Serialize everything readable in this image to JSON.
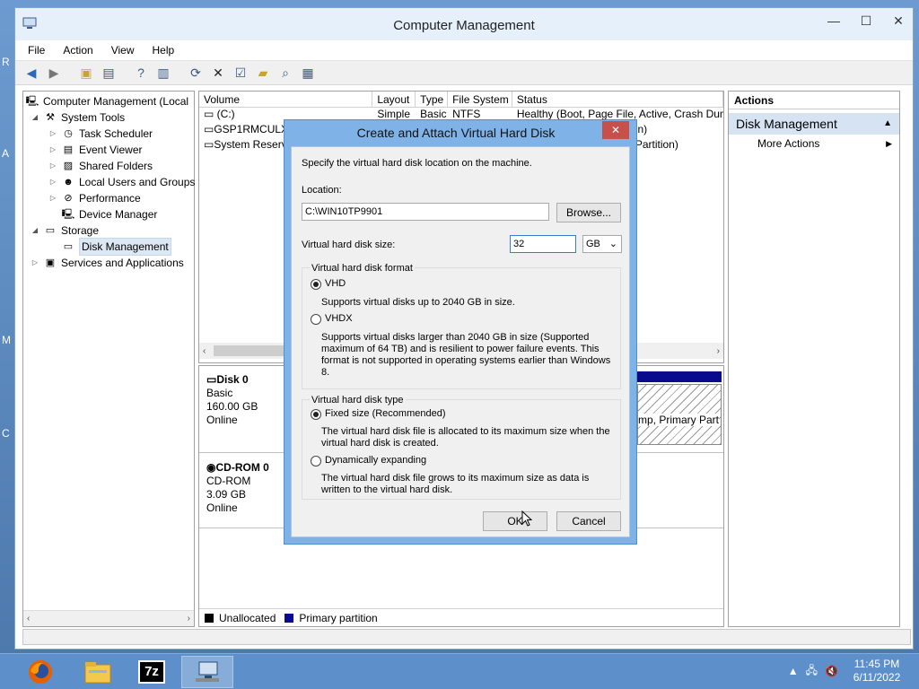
{
  "window": {
    "title": "Computer Management",
    "controls": {
      "minimize": "—",
      "maximize": "☐",
      "close": "✕"
    }
  },
  "menu": [
    "File",
    "Action",
    "View",
    "Help"
  ],
  "tree": {
    "items": [
      {
        "label": "Computer Management (Local",
        "icon": "computer-icon",
        "level": 0,
        "expander": ""
      },
      {
        "label": "System Tools",
        "icon": "tools-icon",
        "level": 1,
        "expander": "◢"
      },
      {
        "label": "Task Scheduler",
        "icon": "clock-icon",
        "level": 2,
        "expander": "▷"
      },
      {
        "label": "Event Viewer",
        "icon": "event-viewer-icon",
        "level": 2,
        "expander": "▷"
      },
      {
        "label": "Shared Folders",
        "icon": "shared-folder-icon",
        "level": 2,
        "expander": "▷"
      },
      {
        "label": "Local Users and Groups",
        "icon": "users-icon",
        "level": 2,
        "expander": "▷"
      },
      {
        "label": "Performance",
        "icon": "performance-icon",
        "level": 2,
        "expander": "▷"
      },
      {
        "label": "Device Manager",
        "icon": "device-manager-icon",
        "level": 2,
        "expander": ""
      },
      {
        "label": "Storage",
        "icon": "storage-icon",
        "level": 1,
        "expander": "◢"
      },
      {
        "label": "Disk Management",
        "icon": "disk-management-icon",
        "level": 2,
        "expander": "",
        "selected": true
      },
      {
        "label": "Services and Applications",
        "icon": "services-icon",
        "level": 1,
        "expander": "▷"
      }
    ]
  },
  "volumes": {
    "columns": [
      "Volume",
      "Layout",
      "Type",
      "File System",
      "Status"
    ],
    "rows": [
      [
        "(C:)",
        "Simple",
        "Basic",
        "NTFS",
        "Healthy (Boot, Page File, Active, Crash Dum"
      ],
      [
        "GSP1RMCULXI",
        "",
        "",
        "",
        "n)"
      ],
      [
        "System Reserv",
        "",
        "",
        "",
        "r Partition)"
      ]
    ]
  },
  "disks": [
    {
      "name": "Disk 0",
      "type": "Basic",
      "size": "160.00 GB",
      "status": "Online"
    },
    {
      "name": "CD-ROM 0",
      "type": "CD-ROM",
      "size": "3.09 GB",
      "status": "Online"
    }
  ],
  "partition_label": "mp, Primary Part",
  "legend": [
    {
      "label": "Unallocated",
      "color": "#000000"
    },
    {
      "label": "Primary partition",
      "color": "#0a0a8c"
    }
  ],
  "actions": {
    "header": "Actions",
    "selected": "Disk Management",
    "more": "More Actions"
  },
  "dialog": {
    "title": "Create and Attach Virtual Hard Disk",
    "close": "✕",
    "intro": "Specify the virtual hard disk location on the machine.",
    "location_label": "Location:",
    "location_value": "C:\\WIN10TP9901",
    "browse": "Browse...",
    "size_label": "Virtual hard disk size:",
    "size_value": "32",
    "size_unit": "GB",
    "format_group": "Virtual hard disk format",
    "vhd_label": "VHD",
    "vhd_desc": "Supports virtual disks up to 2040 GB in size.",
    "vhdx_label": "VHDX",
    "vhdx_desc": "Supports virtual disks larger than 2040 GB in size (Supported maximum of 64 TB) and is resilient to power failure events. This format is not supported in operating systems earlier than Windows 8.",
    "type_group": "Virtual hard disk type",
    "fixed_label": "Fixed size (Recommended)",
    "fixed_desc": "The virtual hard disk file is allocated to its maximum size when the virtual hard disk is created.",
    "dynamic_label": "Dynamically expanding",
    "dynamic_desc": "The virtual hard disk file grows to its maximum size as data is written to the virtual hard disk.",
    "ok": "OK",
    "cancel": "Cancel"
  },
  "taskbar": {
    "apps": [
      "firefox-icon",
      "file-explorer-icon",
      "7zip-icon",
      "computer-management-icon"
    ],
    "sevenzip": "7z",
    "time": "11:45 PM",
    "date": "6/11/2022"
  }
}
